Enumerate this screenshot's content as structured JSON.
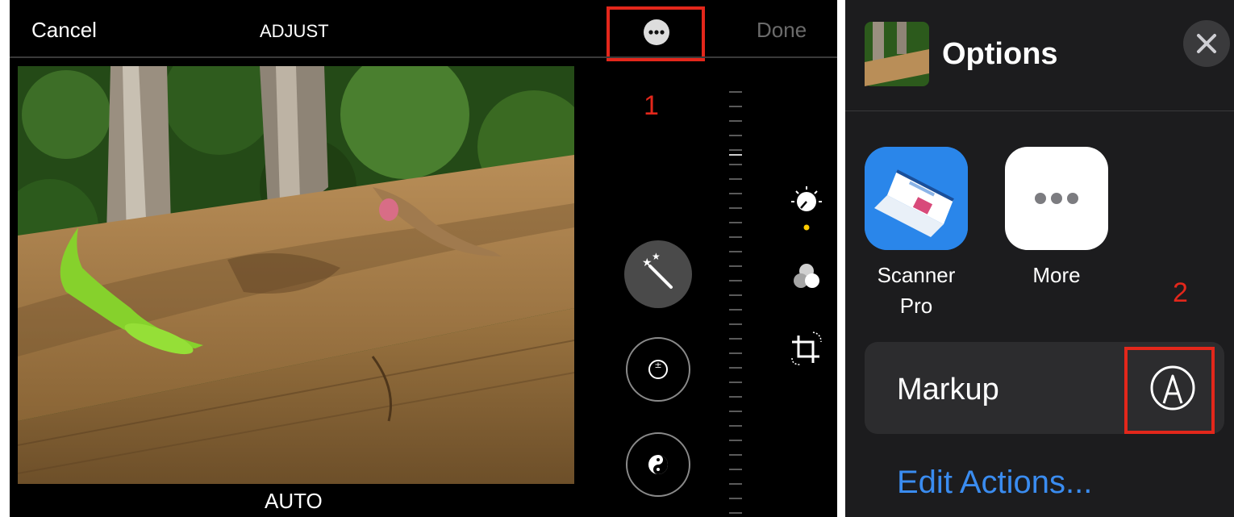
{
  "left_panel": {
    "cancel_label": "Cancel",
    "title": "ADJUST",
    "done_label": "Done",
    "more_icon": "ellipsis-circle-icon",
    "step_number": "1",
    "mode_label": "AUTO",
    "tools": [
      "auto-enhance-icon",
      "exposure-icon",
      "brilliance-icon"
    ],
    "side_icons": [
      "adjust-dial-icon",
      "filters-icon",
      "crop-rotate-icon"
    ]
  },
  "right_panel": {
    "title": "Options",
    "close_icon": "close-icon",
    "apps": [
      {
        "label_line1": "Scanner",
        "label_line2": "Pro",
        "icon": "scanner-pro-app-icon"
      },
      {
        "label_line1": "More",
        "label_line2": "",
        "icon": "more-apps-icon"
      }
    ],
    "step_number": "2",
    "markup_label": "Markup",
    "markup_icon": "markup-pen-icon",
    "edit_actions_label": "Edit Actions..."
  },
  "colors": {
    "annotation_red": "#e3271b",
    "link_blue": "#3a8cf0",
    "active_yellow": "#ffcc00"
  }
}
